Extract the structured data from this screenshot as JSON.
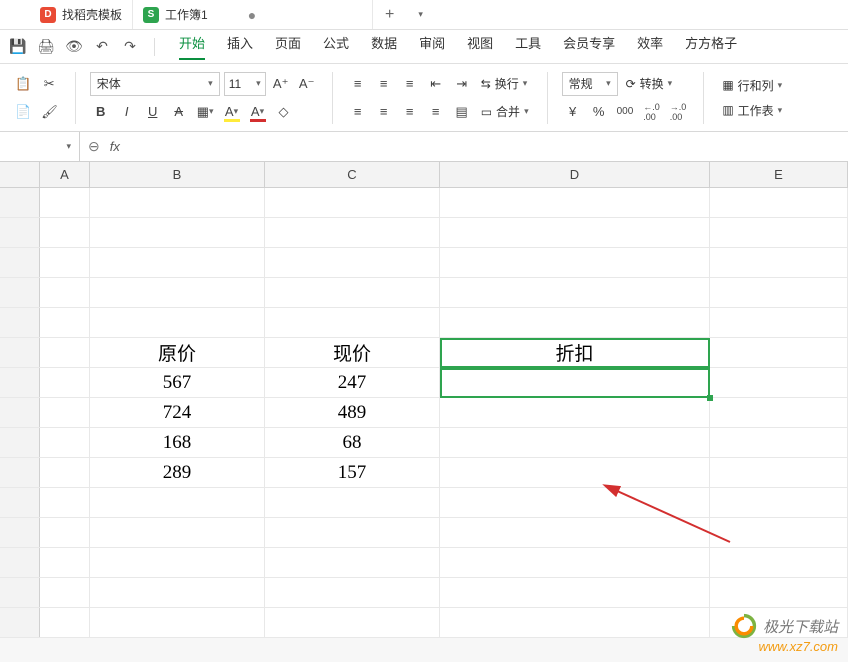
{
  "tabs": {
    "tab1": "找稻壳模板",
    "tab2": "工作簿1",
    "tab1_icon": "D",
    "tab2_icon": "S"
  },
  "menu": {
    "start": "开始",
    "insert": "插入",
    "page": "页面",
    "formula": "公式",
    "data": "数据",
    "review": "审阅",
    "view": "视图",
    "tools": "工具",
    "member": "会员专享",
    "efficiency": "效率",
    "square": "方方格子"
  },
  "ribbon": {
    "font_name": "宋体",
    "font_size": "11",
    "btn_B": "B",
    "btn_I": "I",
    "btn_U": "U",
    "btn_A_inc": "A⁺",
    "btn_A_dec": "A⁻",
    "wrap": "换行",
    "merge": "合并",
    "format": "常规",
    "currency": "¥",
    "percent": "%",
    "thousands": "000",
    "dec_inc": ".0→.00",
    "dec_dec": ".00→.0",
    "convert": "转换",
    "rowcol": "行和列",
    "sheet": "工作表"
  },
  "formula_bar": {
    "name_box": "",
    "fx": "fx",
    "value": ""
  },
  "columns": [
    "A",
    "B",
    "C",
    "D",
    "E"
  ],
  "sheet": {
    "b6": "原价",
    "c6": "现价",
    "d6": "折扣",
    "b7": "567",
    "c7": "247",
    "b8": "724",
    "c8": "489",
    "b9": "168",
    "c9": "68",
    "b10": "289",
    "c10": "157"
  },
  "watermark": {
    "text": "极光下载站",
    "url": "www.xz7.com"
  }
}
